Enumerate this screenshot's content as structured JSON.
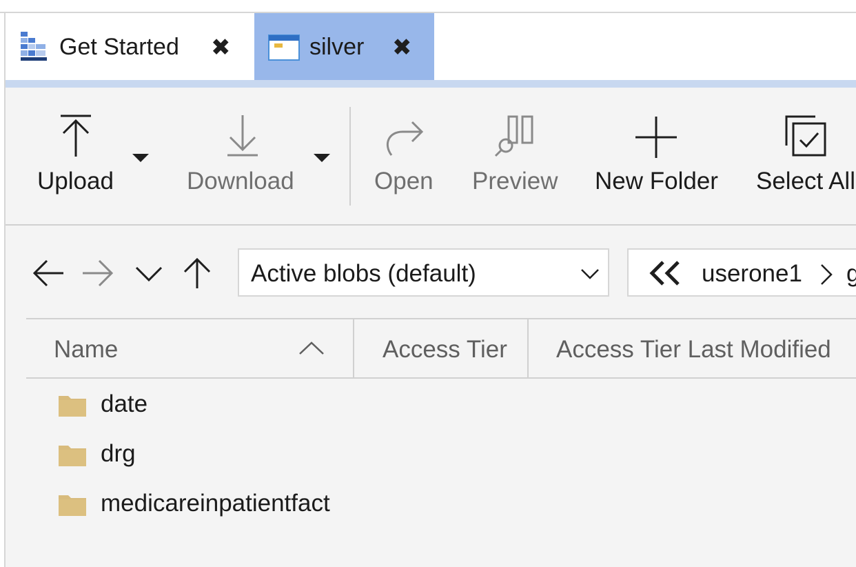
{
  "tabs": [
    {
      "label": "Get Started",
      "icon": "get-started-icon",
      "active": false
    },
    {
      "label": "silver",
      "icon": "container-icon",
      "active": true
    }
  ],
  "toolbar": {
    "upload": "Upload",
    "download": "Download",
    "open": "Open",
    "preview": "Preview",
    "new_folder": "New Folder",
    "select_all": "Select All"
  },
  "nav": {
    "tier_filter": "Active blobs (default)",
    "breadcrumb": [
      "userone1",
      "g"
    ]
  },
  "table": {
    "columns": [
      "Name",
      "Access Tier",
      "Access Tier Last Modified"
    ],
    "rows": [
      {
        "name": "date",
        "icon": "folder-icon"
      },
      {
        "name": "drg",
        "icon": "folder-icon"
      },
      {
        "name": "medicareinpatientfact",
        "icon": "folder-icon"
      }
    ]
  },
  "colors": {
    "active_tab": "#98b7ea",
    "tab_strip": "#c8d8f0",
    "folder": "#d8bb7c",
    "content_bg": "#f4f4f4"
  }
}
